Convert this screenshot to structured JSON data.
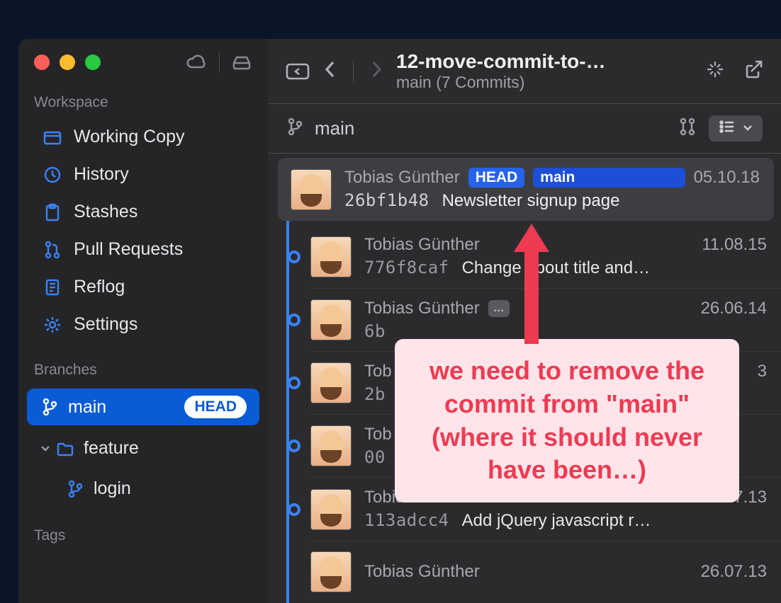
{
  "sidebar": {
    "workspace_label": "Workspace",
    "items": [
      {
        "label": "Working Copy"
      },
      {
        "label": "History"
      },
      {
        "label": "Stashes"
      },
      {
        "label": "Pull Requests"
      },
      {
        "label": "Reflog"
      },
      {
        "label": "Settings"
      }
    ],
    "branches_label": "Branches",
    "branch_main": "main",
    "head_badge": "HEAD",
    "branch_folder": "feature",
    "branch_subs": [
      "login"
    ],
    "tags_label": "Tags"
  },
  "toolbar": {
    "repo_title": "12-move-commit-to-…",
    "repo_sub": "main (7 Commits)"
  },
  "branch_bar": {
    "name": "main"
  },
  "badges": {
    "head": "HEAD",
    "main": "main"
  },
  "commits": [
    {
      "author": "Tobias Günther",
      "date": "05.10.18",
      "hash": "26bf1b48",
      "msg": "Newsletter signup page",
      "selected": true,
      "badges": [
        "head",
        "main"
      ]
    },
    {
      "author": "Tobias Günther",
      "date": "11.08.15",
      "hash": "776f8caf",
      "msg": "Change about title and…"
    },
    {
      "author": "Tobias Günther",
      "date": "26.06.14",
      "hash": "6b",
      "msg": "",
      "sbadge": true
    },
    {
      "author": "Tob",
      "date": "3",
      "hash": "2b",
      "msg": ""
    },
    {
      "author": "Tob",
      "date": "",
      "hash": "00",
      "msg": ""
    },
    {
      "author": "Tobias Günthe",
      "date": "26.07.13",
      "hash": "113adcc4",
      "msg": "Add jQuery javascript r…"
    },
    {
      "author": "Tobias Günther",
      "date": "26.07.13",
      "hash": "",
      "msg": ""
    }
  ],
  "annotation": {
    "text": "we need to remove the commit from \"main\" (where it should never have been…)"
  }
}
